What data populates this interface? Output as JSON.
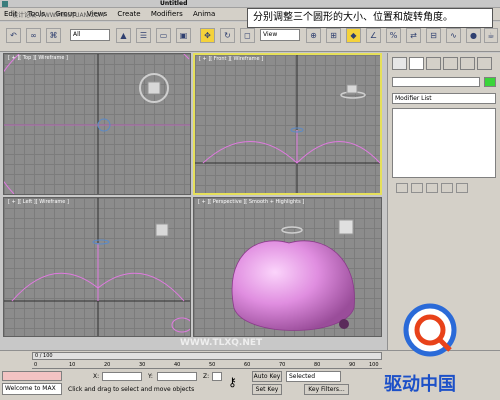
{
  "window": {
    "title": "Untitled"
  },
  "menu": [
    "Edit",
    "Tools",
    "Group",
    "Views",
    "Create",
    "Modifiers",
    "Anima"
  ],
  "toolbar": {
    "selection_filter": "All",
    "reference_coord": "View"
  },
  "callout": {
    "text": "分别调整三个圆形的大小、位置和旋转角度。"
  },
  "viewports": {
    "top": {
      "label": "[ + ][ Top ][ Wireframe ]"
    },
    "front": {
      "label": "[ + ][ Front ][ Wireframe ]"
    },
    "left": {
      "label": "[ + ][ Left ][ Wireframe ]"
    },
    "perspective": {
      "label": "[ + ][ Perspective ][ Smooth + Highlights ]"
    }
  },
  "command_panel": {
    "modifier_list": "Modifier List"
  },
  "timeline": {
    "frame_display": "0 / 100",
    "ticks": [
      "0",
      "10",
      "20",
      "30",
      "40",
      "50",
      "60",
      "70",
      "80",
      "90",
      "100"
    ]
  },
  "status": {
    "listener": "Welcome to MAX",
    "prompt": "Click and drag to select and move objects",
    "x_label": "X:",
    "y_label": "Y:",
    "z_label": "Z:",
    "auto_key": "Auto Key",
    "selected": "Selected",
    "set_key": "Set Key",
    "key_filters": "Key Filters..."
  },
  "watermark": {
    "top": "设计论坛 WWW.MISSYUAN.COM",
    "bottom": "WWW.TLXQ.NET",
    "logo_text": "驱动中国"
  },
  "colors": {
    "viewport_bg": "#8c8c8c",
    "active_border": "#e6e05a",
    "shape_pink": "#e07ae0",
    "circle_blue": "#5a8ac8",
    "apple_fill": "#e08ee0"
  }
}
